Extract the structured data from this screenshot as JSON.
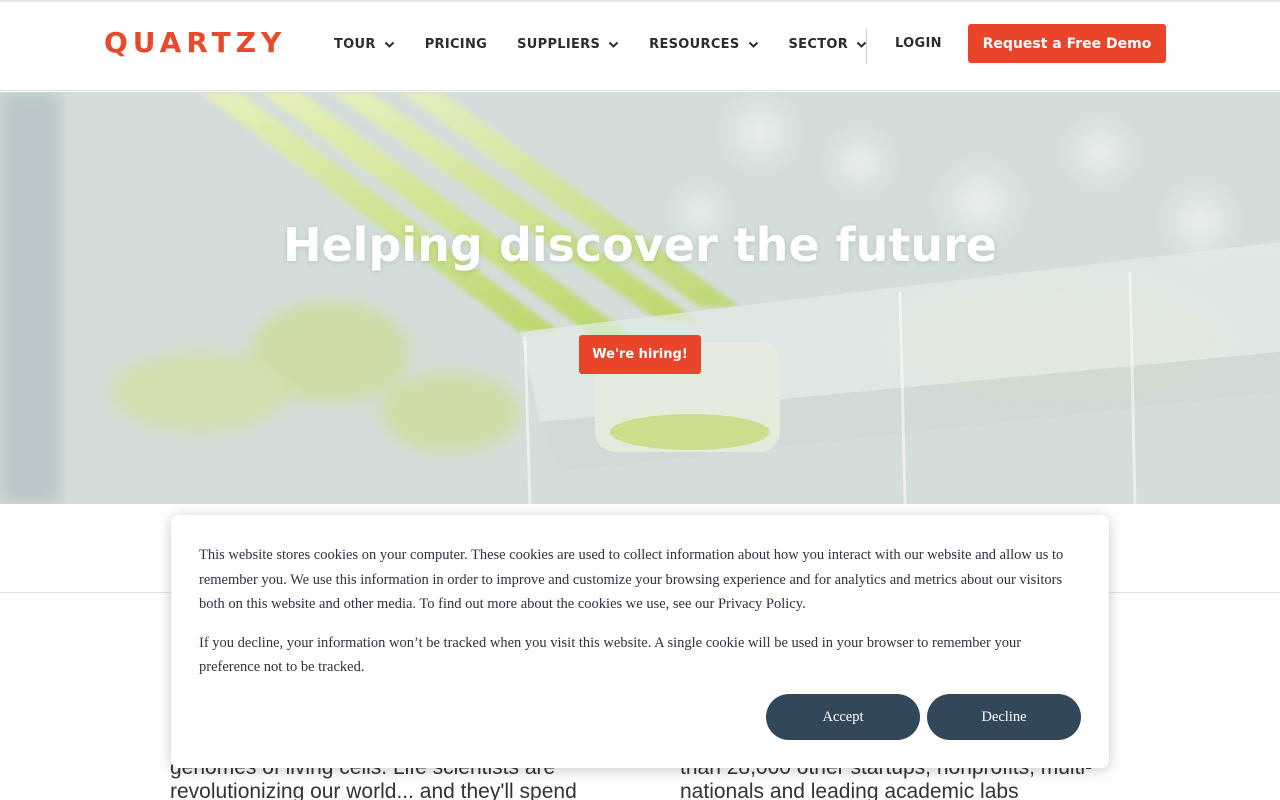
{
  "brand": {
    "logo_text": "QUARTZY",
    "accent_color": "#e8452a",
    "dark_button_color": "#33475b"
  },
  "nav": {
    "items": [
      {
        "label": "TOUR",
        "dropdown": true
      },
      {
        "label": "PRICING",
        "dropdown": false
      },
      {
        "label": "SUPPLIERS",
        "dropdown": true
      },
      {
        "label": "RESOURCES",
        "dropdown": true
      },
      {
        "label": "SECTOR",
        "dropdown": true
      }
    ],
    "login_label": "LOGIN",
    "demo_label": "Request a Free Demo"
  },
  "hero": {
    "title": "Helping discover the future",
    "cta_label": "We're hiring!"
  },
  "body": {
    "left_text": "genomes of living cells. Life scientists are revolutionizing our world... and they'll spend",
    "right_text": "than 28,000 other startups, nonprofits, multi-nationals and leading academic labs"
  },
  "cookie_banner": {
    "paragraph_1": "This website stores cookies on your computer. These cookies are used to collect information about how you interact with our website and allow us to remember you. We use this information in order to improve and customize your browsing experience and for analytics and metrics about our visitors both on this website and other media. To find out more about the cookies we use, see our Privacy Policy.",
    "paragraph_2": "If you decline, your information won’t be tracked when you visit this website. A single cookie will be used in your browser to remember your preference not to be tracked.",
    "accept_label": "Accept",
    "decline_label": "Decline"
  }
}
